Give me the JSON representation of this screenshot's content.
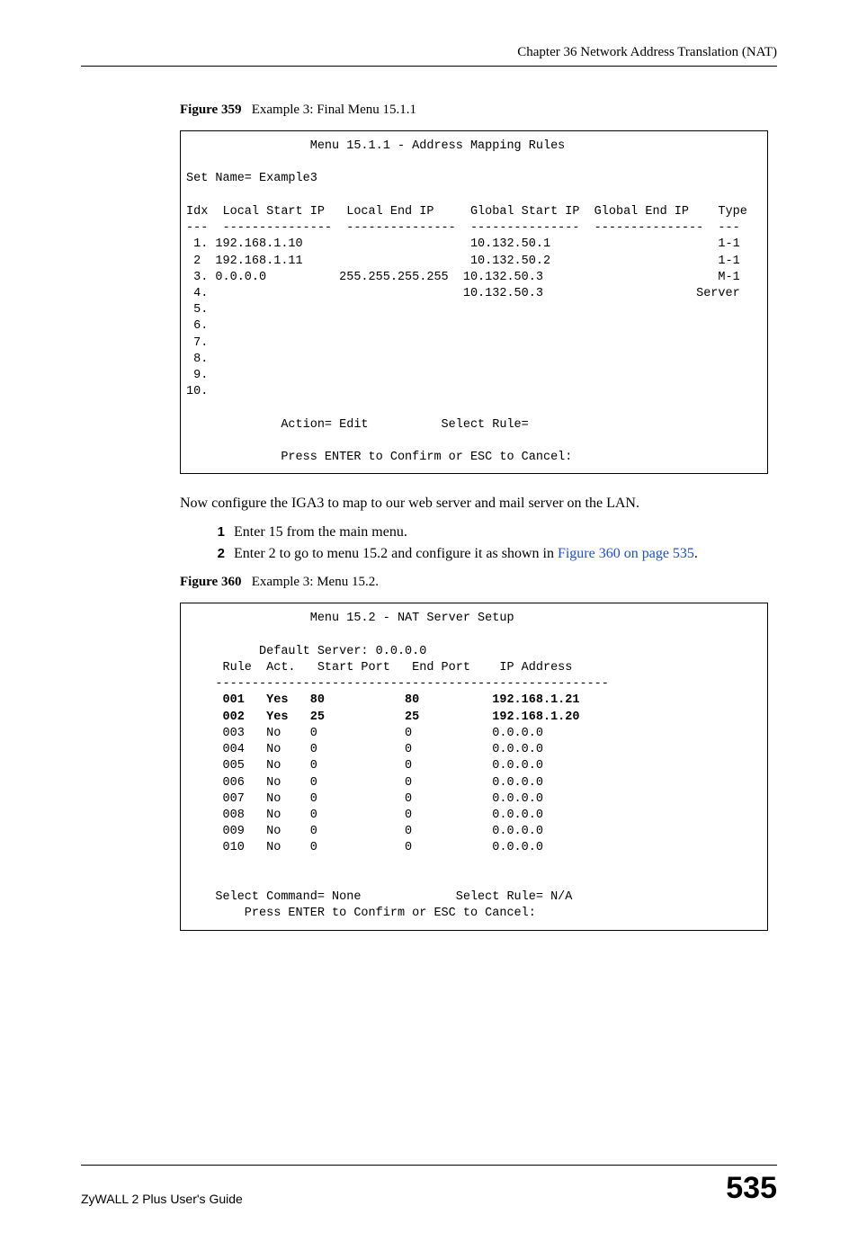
{
  "header": {
    "chapter": "Chapter 36 Network Address Translation (NAT)"
  },
  "figure359": {
    "label": "Figure 359",
    "desc": "Example 3: Final Menu 15.1.1",
    "terminal": "                 Menu 15.1.1 - Address Mapping Rules\n\nSet Name= Example3\n\nIdx  Local Start IP   Local End IP     Global Start IP  Global End IP    Type\n---  ---------------  ---------------  ---------------  ---------------  ---\n 1. 192.168.1.10                       10.132.50.1                       1-1\n 2  192.168.1.11                       10.132.50.2                       1-1\n 3. 0.0.0.0          255.255.255.255  10.132.50.3                        M-1\n 4.                                   10.132.50.3                     Server\n 5.\n 6.\n 7.\n 8.\n 9.\n10.\n\n             Action= Edit          Select Rule=\n\n             Press ENTER to Confirm or ESC to Cancel:"
  },
  "body1": "Now configure the IGA3 to map to our web server and mail server on the LAN.",
  "steps": {
    "s1num": "1",
    "s1": "Enter 15 from the main menu.",
    "s2num": "2",
    "s2a": "Enter 2 to go to menu 15.2 and configure it as shown in ",
    "s2link": "Figure 360 on page 535",
    "s2b": "."
  },
  "figure360": {
    "label": "Figure 360",
    "desc": "Example 3: Menu 15.2.",
    "terminal_plain": "                 Menu 15.2 - NAT Server Setup\n\n          Default Server: 0.0.0.0\n     Rule  Act.   Start Port   End Port    IP Address\n    ------------------------------------------------------\n",
    "terminal_bold": "     001   Yes   80           80          192.168.1.21\n     002   Yes   25           25          192.168.1.20\n",
    "terminal_rest": "     003   No    0            0           0.0.0.0\n     004   No    0            0           0.0.0.0\n     005   No    0            0           0.0.0.0\n     006   No    0            0           0.0.0.0\n     007   No    0            0           0.0.0.0\n     008   No    0            0           0.0.0.0\n     009   No    0            0           0.0.0.0\n     010   No    0            0           0.0.0.0\n\n\n    Select Command= None             Select Rule= N/A\n        Press ENTER to Confirm or ESC to Cancel:"
  },
  "footer": {
    "left": "ZyWALL 2 Plus User's Guide",
    "right": "535"
  }
}
